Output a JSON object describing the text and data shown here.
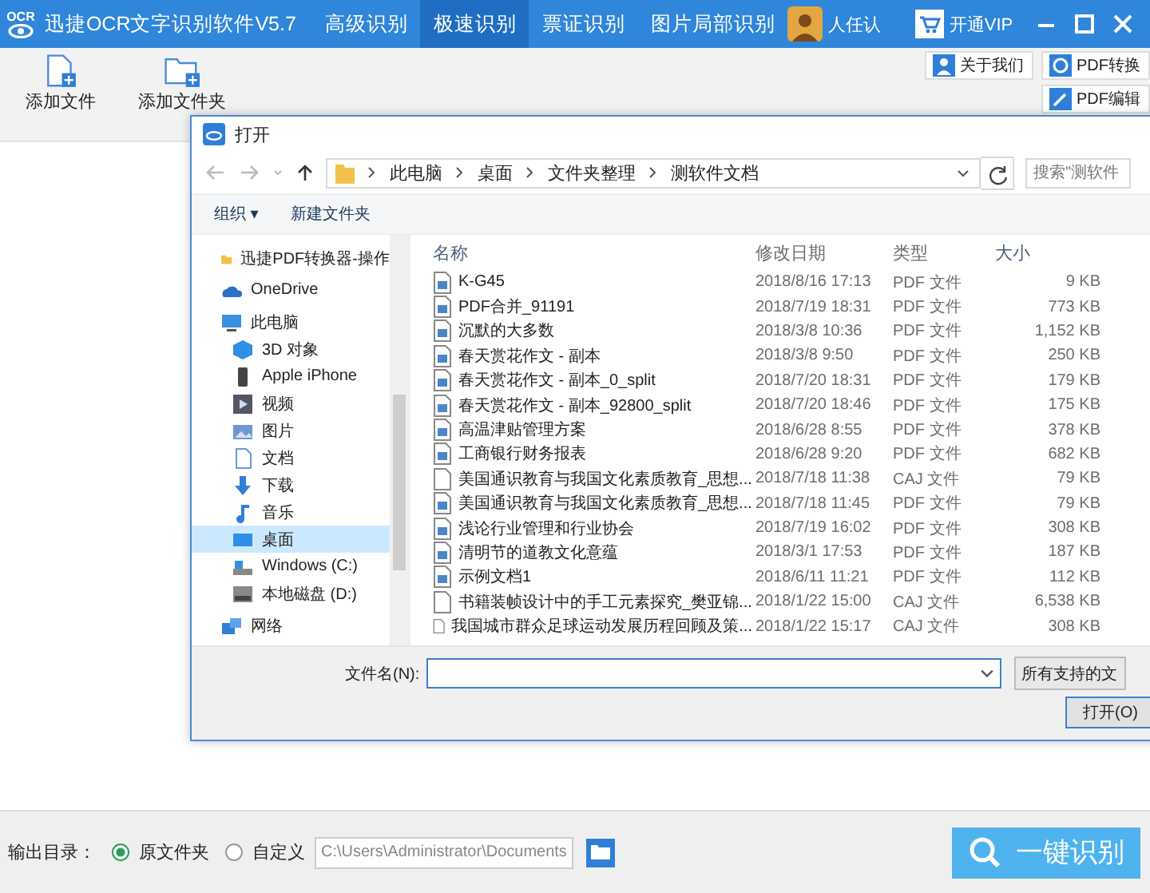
{
  "app": {
    "logo": "OCR",
    "title": "迅捷OCR文字识别软件V5.7",
    "tabs": [
      {
        "label": "高级识别",
        "selected": false
      },
      {
        "label": "极速识别",
        "selected": true
      },
      {
        "label": "票证识别",
        "selected": false
      },
      {
        "label": "图片局部识别",
        "selected": false
      }
    ],
    "user": "人任认",
    "vip": "开通VIP"
  },
  "toolbar": {
    "buttons": [
      {
        "label": "添加文件",
        "kind": "file"
      },
      {
        "label": "添加文件夹",
        "kind": "folder"
      }
    ],
    "side_buttons": [
      {
        "label": "关于我们",
        "kind": "person"
      },
      {
        "label": "PDF转换",
        "kind": "convert"
      },
      {
        "label": "PDF编辑",
        "kind": "edit"
      }
    ]
  },
  "dialog": {
    "title": "打开",
    "path": [
      "此电脑",
      "桌面",
      "文件夹整理",
      "测软件文档"
    ],
    "search": {
      "placeholder": "搜索\"测软件"
    },
    "commands": [
      "组织 ▾",
      "新建文件夹"
    ],
    "nav": [
      {
        "label": "迅捷PDF转换器-操作",
        "kind": "folder",
        "selected": false
      },
      {
        "label": "OneDrive",
        "kind": "cloud",
        "selected": false
      },
      {
        "label": "此电脑",
        "kind": "pc",
        "selected": false
      },
      {
        "label": "3D 对象",
        "kind": "cube",
        "selected": false
      },
      {
        "label": "Apple iPhone",
        "kind": "phone",
        "selected": false
      },
      {
        "label": "视频",
        "kind": "video",
        "selected": false
      },
      {
        "label": "图片",
        "kind": "image",
        "selected": false
      },
      {
        "label": "文档",
        "kind": "doc",
        "selected": false
      },
      {
        "label": "下载",
        "kind": "download",
        "selected": false
      },
      {
        "label": "音乐",
        "kind": "music",
        "selected": false
      },
      {
        "label": "桌面",
        "kind": "desktop",
        "selected": true
      },
      {
        "label": "Windows (C:)",
        "kind": "drive",
        "selected": false
      },
      {
        "label": "本地磁盘 (D:)",
        "kind": "disk",
        "selected": false
      },
      {
        "label": "网络",
        "kind": "network",
        "selected": false
      }
    ],
    "columns": [
      "名称",
      "修改日期",
      "类型",
      "大小"
    ],
    "files": [
      {
        "name": "K-G45",
        "date": "2018/8/16 17:13",
        "type": "PDF 文件",
        "size": "9 KB",
        "kind": "pdf"
      },
      {
        "name": "PDF合并_91191",
        "date": "2018/7/19 18:31",
        "type": "PDF 文件",
        "size": "773 KB",
        "kind": "pdf"
      },
      {
        "name": "沉默的大多数",
        "date": "2018/3/8 10:36",
        "type": "PDF 文件",
        "size": "1,152 KB",
        "kind": "pdf"
      },
      {
        "name": "春天赏花作文 - 副本",
        "date": "2018/3/8 9:50",
        "type": "PDF 文件",
        "size": "250 KB",
        "kind": "pdf"
      },
      {
        "name": "春天赏花作文 - 副本_0_split",
        "date": "2018/7/20 18:31",
        "type": "PDF 文件",
        "size": "179 KB",
        "kind": "pdf"
      },
      {
        "name": "春天赏花作文 - 副本_92800_split",
        "date": "2018/7/20 18:46",
        "type": "PDF 文件",
        "size": "175 KB",
        "kind": "pdf"
      },
      {
        "name": "高温津贴管理方案",
        "date": "2018/6/28 8:55",
        "type": "PDF 文件",
        "size": "378 KB",
        "kind": "pdf"
      },
      {
        "name": "工商银行财务报表",
        "date": "2018/6/28 9:20",
        "type": "PDF 文件",
        "size": "682 KB",
        "kind": "pdf"
      },
      {
        "name": "美国通识教育与我国文化素质教育_思想...",
        "date": "2018/7/18 11:38",
        "type": "CAJ 文件",
        "size": "79 KB",
        "kind": "caj"
      },
      {
        "name": "美国通识教育与我国文化素质教育_思想...",
        "date": "2018/7/18 11:45",
        "type": "PDF 文件",
        "size": "79 KB",
        "kind": "pdf"
      },
      {
        "name": "浅论行业管理和行业协会",
        "date": "2018/7/19 16:02",
        "type": "PDF 文件",
        "size": "308 KB",
        "kind": "pdf"
      },
      {
        "name": "清明节的道教文化意蕴",
        "date": "2018/3/1 17:53",
        "type": "PDF 文件",
        "size": "187 KB",
        "kind": "pdf"
      },
      {
        "name": "示例文档1",
        "date": "2018/6/11 11:21",
        "type": "PDF 文件",
        "size": "112 KB",
        "kind": "pdf"
      },
      {
        "name": "书籍装帧设计中的手工元素探究_樊亚锦...",
        "date": "2018/1/22 15:00",
        "type": "CAJ 文件",
        "size": "6,538 KB",
        "kind": "caj"
      },
      {
        "name": "我国城市群众足球运动发展历程回顾及策...",
        "date": "2018/1/22 15:17",
        "type": "CAJ 文件",
        "size": "308 KB",
        "kind": "caj"
      }
    ],
    "filename_label": "文件名(N):",
    "filetype": "所有支持的文",
    "open_button": "打开(O)"
  },
  "bottom": {
    "label": "输出目录：",
    "options": [
      {
        "label": "原文件夹",
        "selected": true
      },
      {
        "label": "自定义",
        "selected": false
      }
    ],
    "path": "C:\\Users\\Administrator\\Documents",
    "action": "一键识别"
  }
}
